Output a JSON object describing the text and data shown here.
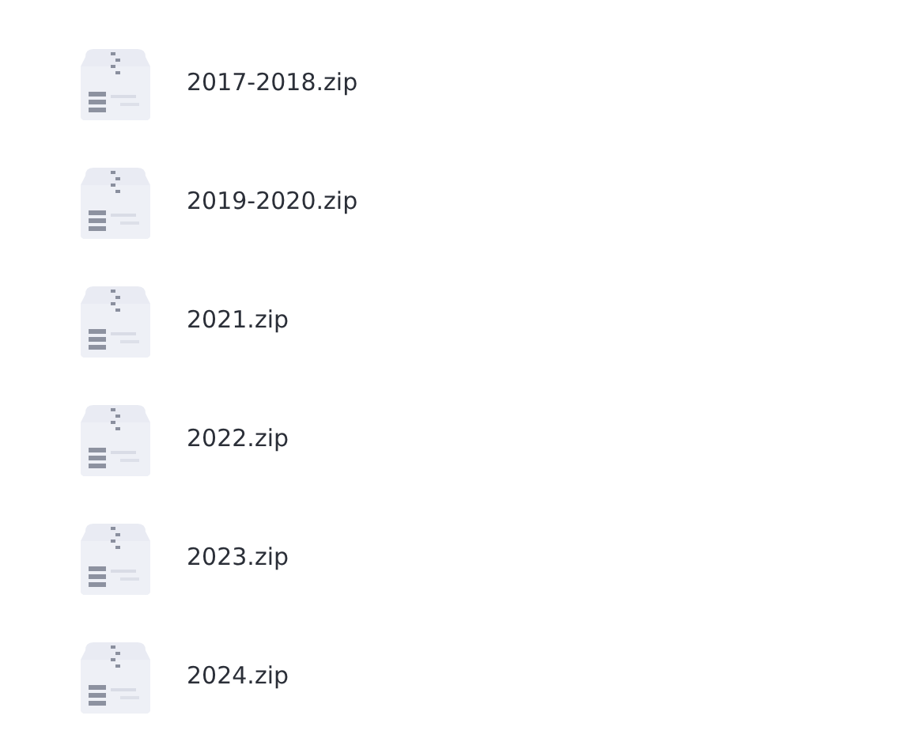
{
  "files": [
    {
      "name": "2017-2018.zip"
    },
    {
      "name": "2019-2020.zip"
    },
    {
      "name": "2021.zip"
    },
    {
      "name": "2022.zip"
    },
    {
      "name": "2023.zip"
    },
    {
      "name": "2024.zip"
    }
  ]
}
